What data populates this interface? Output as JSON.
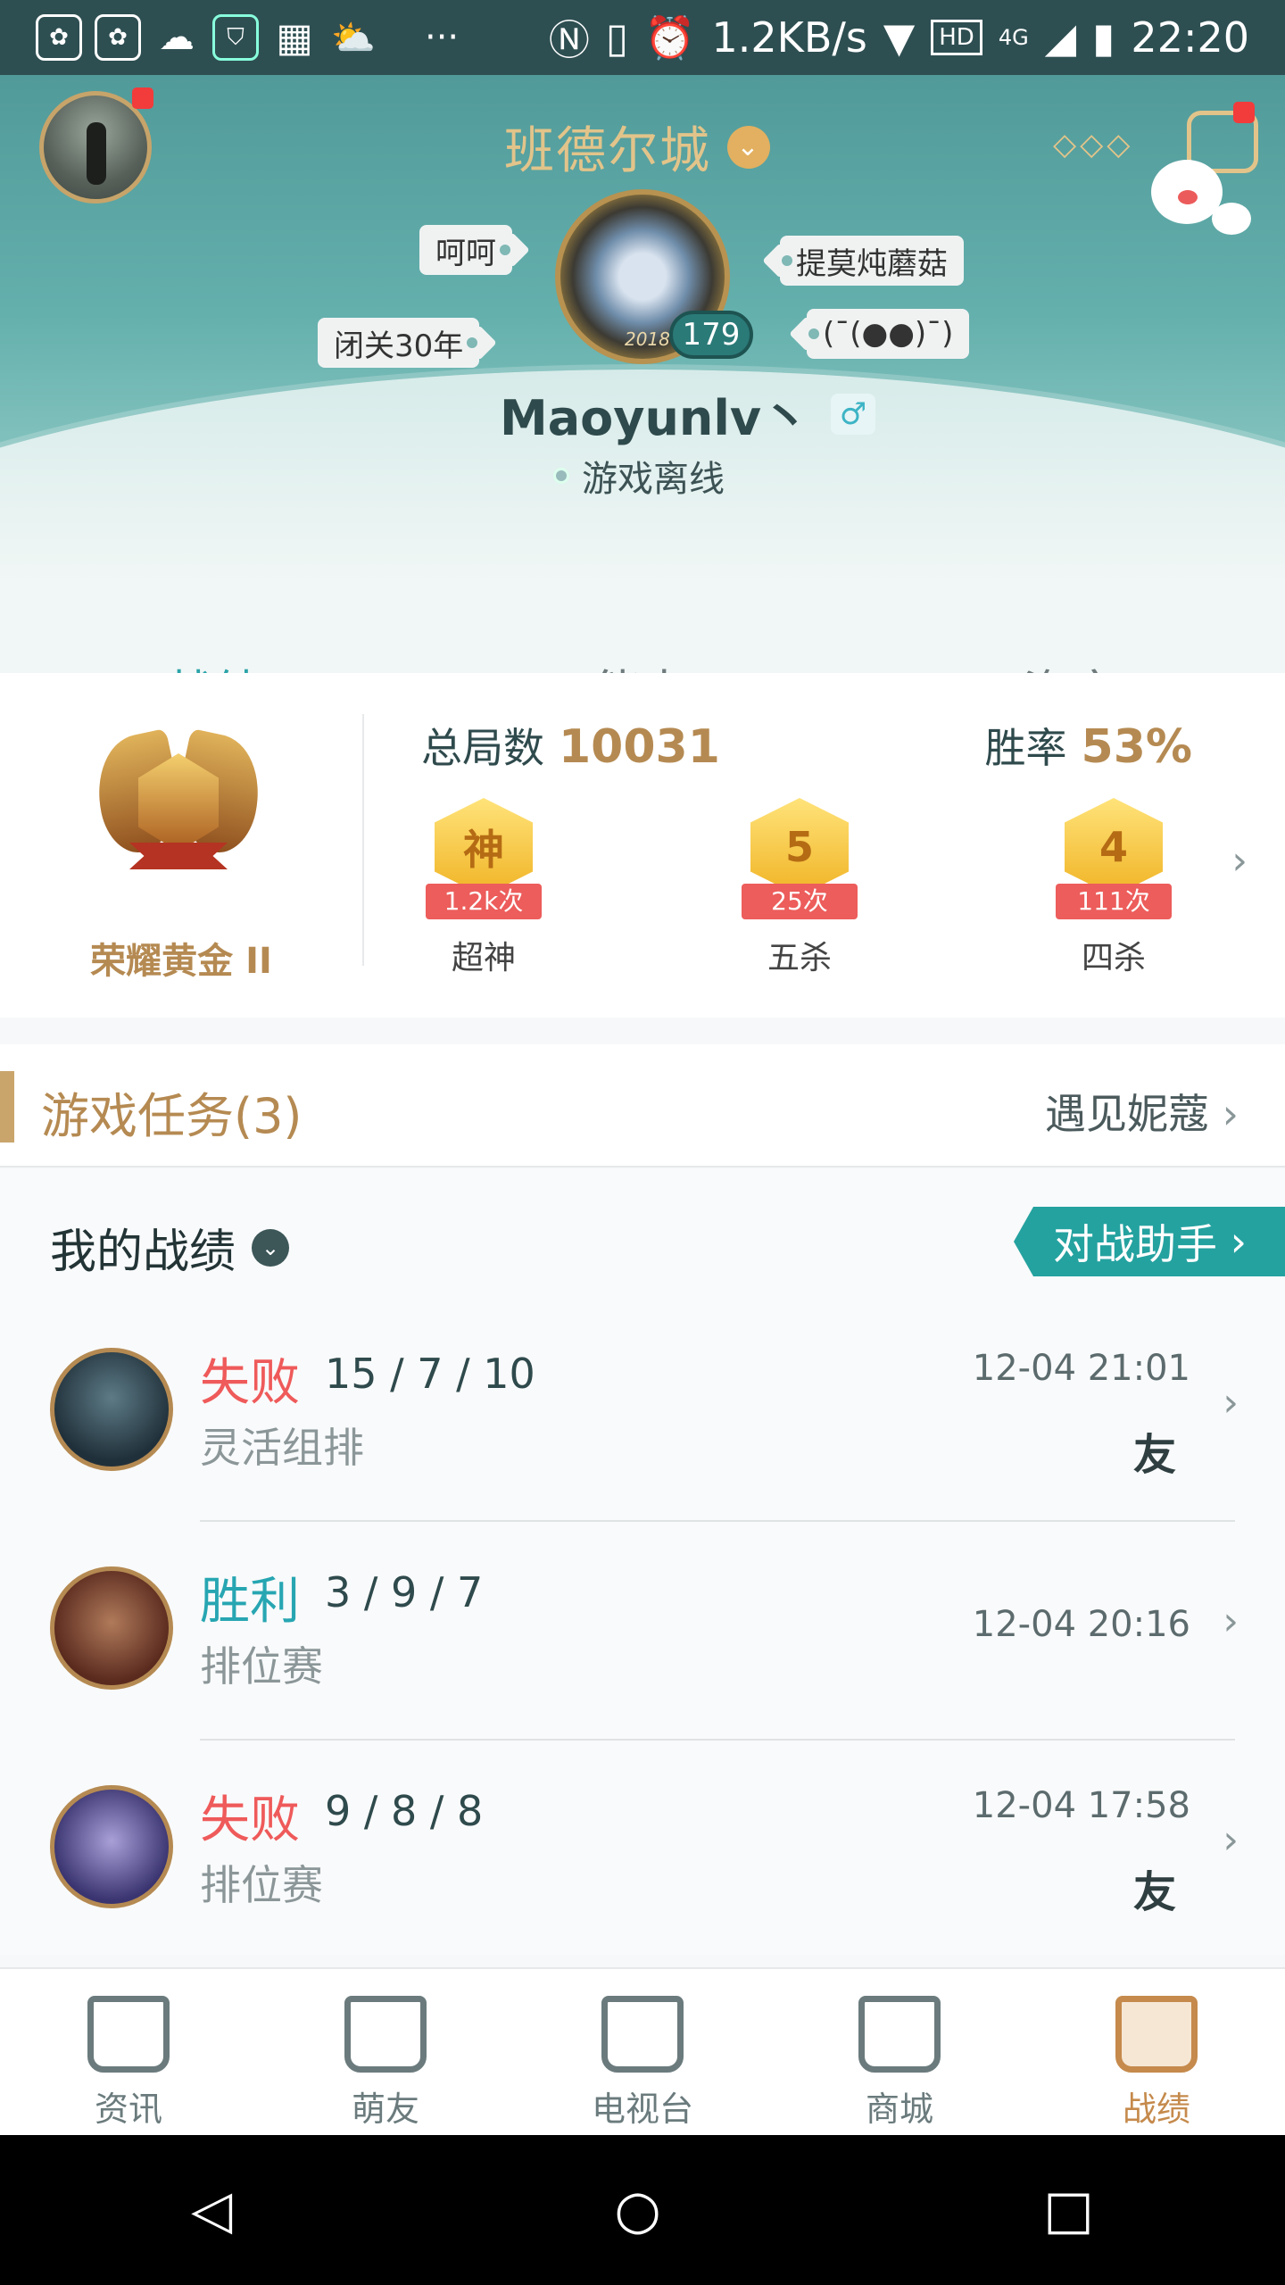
{
  "status": {
    "icons": [
      "baidu-paw-icon",
      "baidu-paw-icon",
      "wechat-icon",
      "shield-icon",
      "grid-icon",
      "weather-icon"
    ],
    "dots": "···",
    "net": "1.2KB/s",
    "hd": "HD",
    "net_type": "4G",
    "time": "22:20"
  },
  "header": {
    "server": "班德尔城",
    "tags": [
      "呵呵",
      "提莫炖蘑菇",
      "闭关30年",
      "(¯(●●)¯)"
    ],
    "year": "2018",
    "level": "179",
    "username": "Maoyunlv丶",
    "gender": "♂",
    "online": "游戏离线",
    "more": "◇◇◇"
  },
  "tabs": [
    {
      "label": "战绩"
    },
    {
      "label": "能力"
    },
    {
      "label": "资产"
    }
  ],
  "stats": {
    "rank": "荣耀黄金 II",
    "total_label": "总局数",
    "total": "10031",
    "winrate_label": "胜率",
    "winrate": "53%",
    "medals": [
      {
        "icon": "神",
        "count": "1.2k次",
        "label": "超神"
      },
      {
        "icon": "5",
        "count": "25次",
        "label": "五杀"
      },
      {
        "icon": "4",
        "count": "111次",
        "label": "四杀"
      }
    ]
  },
  "task": {
    "title": "游戏任务(3)",
    "link": "遇见妮蔻"
  },
  "mine": {
    "title": "我的战绩",
    "assist": "对战助手",
    "rows": [
      {
        "result": "失败",
        "kda": "15 / 7 / 10",
        "mode": "灵活组排",
        "time": "12-04 21:01",
        "friend": "友"
      },
      {
        "result": "胜利",
        "kda": "3 / 9 / 7",
        "mode": "排位赛",
        "time": "12-04 20:16",
        "friend": ""
      },
      {
        "result": "失败",
        "kda": "9 / 8 / 8",
        "mode": "排位赛",
        "time": "12-04 17:58",
        "friend": "友"
      }
    ]
  },
  "nav": [
    {
      "label": "资讯"
    },
    {
      "label": "萌友"
    },
    {
      "label": "电视台"
    },
    {
      "label": "商城"
    },
    {
      "label": "战绩"
    }
  ],
  "colors": {
    "accent": "#2aa3a8",
    "gold": "#b58a52",
    "lose": "#ef5a5a",
    "win": "#27a6b2"
  }
}
